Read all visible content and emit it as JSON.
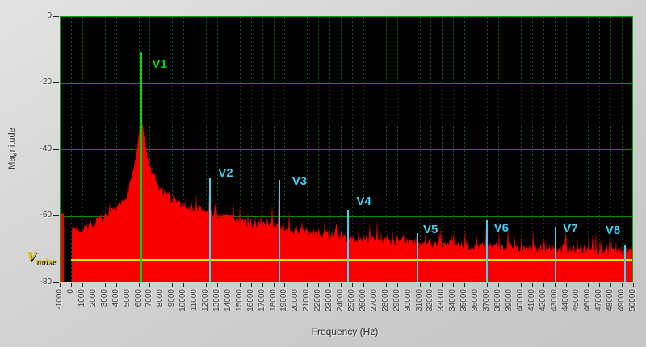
{
  "chart_data": {
    "type": "line",
    "title": "",
    "xlabel": "Frequency (Hz)",
    "ylabel": "Magnitude",
    "xlim": [
      -1000,
      50000
    ],
    "ylim": [
      -80,
      0
    ],
    "x_ticks": [
      -1000,
      0,
      1000,
      2000,
      3000,
      4000,
      5000,
      6000,
      7000,
      8000,
      9000,
      10000,
      11000,
      12000,
      13000,
      14000,
      15000,
      16000,
      17000,
      18000,
      19000,
      20000,
      21000,
      22000,
      23000,
      24000,
      25000,
      26000,
      27000,
      28000,
      29000,
      30000,
      31000,
      32000,
      33000,
      34000,
      35000,
      36000,
      37000,
      38000,
      39000,
      40000,
      41000,
      42000,
      43000,
      44000,
      45000,
      46000,
      47000,
      48000,
      49000,
      50000
    ],
    "y_ticks": [
      0,
      -20,
      -40,
      -60,
      -80
    ],
    "grid": {
      "vertical": "dotted every 1000 Hz",
      "horizontal": "solid every 20 dB",
      "frame_color": "#00a800",
      "vgrid_color": "#0e5c0e",
      "hgrid_color": "#008c00"
    },
    "legend": "none",
    "series": [
      {
        "name": "spectrum-magnitude",
        "color": "#fa0000",
        "fundamental_hz": 6150,
        "peak_db": -29,
        "noise_seed": 7,
        "envelope_points": [
          [
            0,
            -63
          ],
          [
            700,
            -63.5
          ],
          [
            1200,
            -63
          ],
          [
            1800,
            -62
          ],
          [
            2400,
            -61
          ],
          [
            3000,
            -60
          ],
          [
            3600,
            -58.8
          ],
          [
            4200,
            -57
          ],
          [
            4700,
            -54.5
          ],
          [
            5100,
            -50.5
          ],
          [
            5500,
            -45.5
          ],
          [
            5800,
            -40
          ],
          [
            6000,
            -34.5
          ],
          [
            6150,
            -29
          ],
          [
            6300,
            -32.5
          ],
          [
            6500,
            -37.5
          ],
          [
            6800,
            -43
          ],
          [
            7200,
            -47.5
          ],
          [
            7800,
            -51.5
          ],
          [
            8600,
            -54
          ],
          [
            9600,
            -55.8
          ],
          [
            10800,
            -57
          ],
          [
            12000,
            -58
          ],
          [
            13200,
            -59.5
          ],
          [
            14500,
            -60.5
          ],
          [
            16000,
            -61.8
          ],
          [
            17500,
            -62.4
          ],
          [
            19000,
            -63.2
          ],
          [
            20500,
            -64.2
          ],
          [
            22000,
            -65
          ],
          [
            24000,
            -65.8
          ],
          [
            26000,
            -66.4
          ],
          [
            28000,
            -67
          ],
          [
            30000,
            -67.5
          ],
          [
            32000,
            -68
          ],
          [
            34000,
            -68.2
          ],
          [
            36000,
            -68.5
          ],
          [
            38000,
            -68.7
          ],
          [
            40000,
            -69
          ],
          [
            42000,
            -69.2
          ],
          [
            44000,
            -69.4
          ],
          [
            46000,
            -69.6
          ],
          [
            48000,
            -69.9
          ],
          [
            50000,
            -70
          ]
        ],
        "spikes": [
          [
            8000,
            -52
          ],
          [
            9200,
            -55
          ],
          [
            10500,
            -56
          ],
          [
            11400,
            -57
          ],
          [
            12250,
            -52
          ],
          [
            12700,
            -56
          ],
          [
            13500,
            -59
          ],
          [
            14200,
            -60
          ],
          [
            15700,
            -58
          ],
          [
            16800,
            -60
          ],
          [
            17800,
            -56
          ],
          [
            18400,
            -50.5
          ],
          [
            19300,
            -58
          ],
          [
            20500,
            -61
          ],
          [
            21500,
            -62
          ],
          [
            22500,
            -61
          ],
          [
            23500,
            -63
          ],
          [
            24550,
            -59
          ],
          [
            25500,
            -63
          ],
          [
            26500,
            -62
          ],
          [
            27500,
            -64
          ],
          [
            28500,
            -63
          ],
          [
            29500,
            -65
          ],
          [
            30700,
            -66
          ],
          [
            31500,
            -64
          ],
          [
            32800,
            -63
          ],
          [
            34000,
            -65
          ],
          [
            35000,
            -64
          ],
          [
            36000,
            -65
          ],
          [
            36850,
            -62
          ],
          [
            38000,
            -64
          ],
          [
            38800,
            -63
          ],
          [
            40000,
            -65
          ],
          [
            41000,
            -64
          ],
          [
            42000,
            -66
          ],
          [
            43000,
            -64
          ],
          [
            44000,
            -65
          ],
          [
            45000,
            -66
          ],
          [
            46000,
            -65
          ],
          [
            47000,
            -67
          ],
          [
            48000,
            -66
          ],
          [
            49150,
            -69
          ]
        ],
        "edge_spike": {
          "f_start": -1000,
          "f_end": -720,
          "db": -59
        }
      }
    ],
    "cursors": [
      {
        "label": "V1",
        "freq": 6150,
        "top_db": -10.5,
        "color": "#00d800",
        "width": 3,
        "label_dx": 14,
        "label_dy": 8
      },
      {
        "label": "V2",
        "freq": 12300,
        "top_db": -48.5,
        "color": "#3fd2f2",
        "width": 2,
        "label_dx": 10,
        "label_dy": -14
      },
      {
        "label": "V3",
        "freq": 18450,
        "top_db": -49,
        "color": "#3fd2f2",
        "width": 2,
        "label_dx": 16,
        "label_dy": -6
      },
      {
        "label": "V4",
        "freq": 24600,
        "top_db": -58,
        "color": "#3fd2f2",
        "width": 2,
        "label_dx": 10,
        "label_dy": -18
      },
      {
        "label": "V5",
        "freq": 30750,
        "top_db": -65,
        "color": "#3fd2f2",
        "width": 2,
        "label_dx": 7,
        "label_dy": -12
      },
      {
        "label": "V6",
        "freq": 36900,
        "top_db": -61,
        "color": "#3fd2f2",
        "width": 2,
        "label_dx": 9,
        "label_dy": 2
      },
      {
        "label": "V7",
        "freq": 43050,
        "top_db": -63,
        "color": "#3fd2f2",
        "width": 2,
        "label_dx": 9,
        "label_dy": -5
      },
      {
        "label": "V8",
        "freq": 49200,
        "top_db": -68.5,
        "color": "#3fd2f2",
        "width": 2,
        "label_dx": -24,
        "label_dy": -26
      }
    ],
    "noise_cursor": {
      "label": "V",
      "sub": "noise",
      "level_db": -73,
      "line_color": "#f8ea00",
      "label_color": "#dcc900"
    }
  },
  "colors": {
    "background": "#d2d2d2",
    "plot_background": "#000000",
    "tick_text": "#3a3a3a"
  }
}
